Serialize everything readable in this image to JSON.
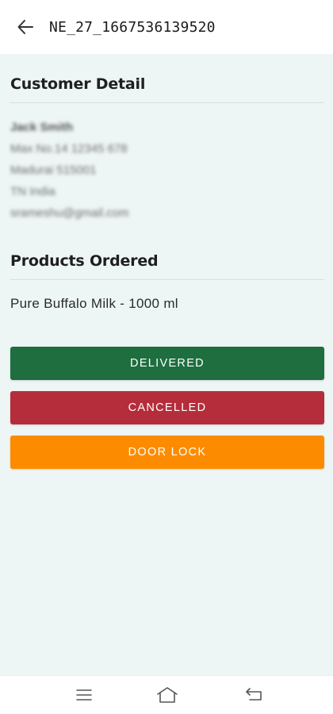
{
  "app_bar": {
    "title": "NE_27_1667536139520",
    "back_icon": "arrow-left-icon"
  },
  "customer": {
    "heading": "Customer Detail",
    "name": "Jack Smith",
    "address_line1": "Max No.14 12345 678",
    "address_line2": "Madurai 515001",
    "address_line3": "TN India",
    "email": "srameshu@gmail.com"
  },
  "products": {
    "heading": "Products Ordered",
    "items": [
      "Pure Buffalo Milk - 1000 ml"
    ]
  },
  "actions": {
    "delivered_label": "DELIVERED",
    "cancelled_label": "CANCELLED",
    "doorlock_label": "DOOR LOCK"
  },
  "colors": {
    "delivered": "#1e6e3f",
    "cancelled": "#b52d3a",
    "doorlock": "#fd8b00",
    "background": "#eef5f5"
  },
  "nav_bar": {
    "icons": [
      "menu-icon",
      "home-icon",
      "back-icon"
    ]
  }
}
